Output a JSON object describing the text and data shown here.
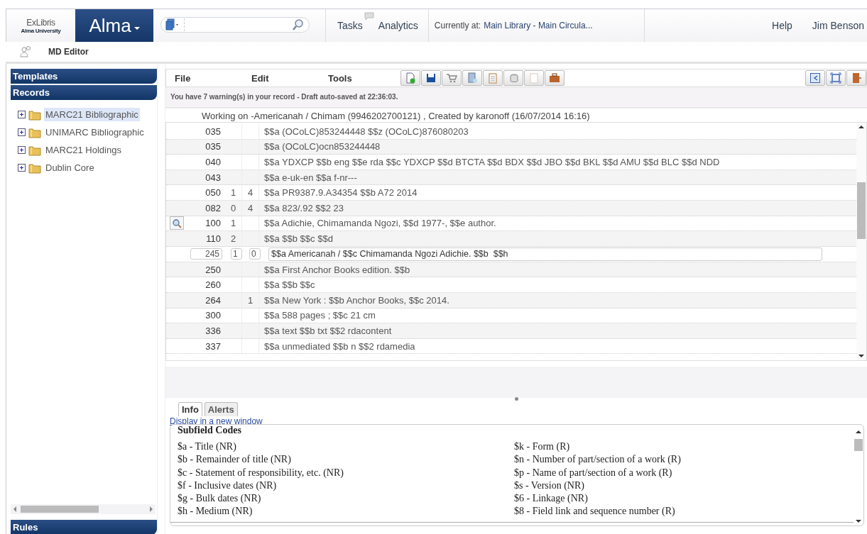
{
  "header": {
    "logo_top": "ExLibris",
    "logo_bottom": "Alma University",
    "app_name": "Alma",
    "nav": [
      "Tasks",
      "Analytics"
    ],
    "location_label": "Currently at:",
    "location": "Main Library - Main Circula...",
    "help": "Help",
    "user": "Jim Benson"
  },
  "subbar": {
    "title": "MD Editor"
  },
  "sidebar": {
    "sections": [
      "Templates",
      "Records"
    ],
    "items": [
      {
        "label": "MARC21 Bibliographic",
        "selected": true
      },
      {
        "label": "UNIMARC Bibliographic",
        "selected": false
      },
      {
        "label": "MARC21 Holdings",
        "selected": false
      },
      {
        "label": "Dublin Core",
        "selected": false
      }
    ],
    "footer": "Rules"
  },
  "editor": {
    "menu": [
      "File",
      "Edit",
      "Tools"
    ],
    "warning": "You have 7 warning(s) in your record - Draft auto-saved at 22:36:03.",
    "working_on": "Working on -Americanah / Chimam (9946202700121) , Created by karonoff (16/07/2014 16:16)",
    "rows": [
      {
        "kind": "field",
        "tag": "035",
        "ind1": "",
        "ind2": "",
        "value": "$$a (OCoLC)853244448 $$z (OCoLC)876080203",
        "lookup": false
      },
      {
        "kind": "field",
        "tag": "035",
        "ind1": "",
        "ind2": "",
        "value": "$$a (OCoLC)ocn853244448",
        "lookup": false
      },
      {
        "kind": "field",
        "tag": "040",
        "ind1": "",
        "ind2": "",
        "value": "$$a YDXCP $$b eng $$e rda $$c YDXCP $$d BTCTA $$d BDX $$d JBO $$d BKL $$d AMU $$d BLC $$d NDD",
        "lookup": false
      },
      {
        "kind": "field",
        "tag": "043",
        "ind1": "",
        "ind2": "",
        "value": "$$a e-uk-en $$a f-nr---",
        "lookup": false
      },
      {
        "kind": "field",
        "tag": "050",
        "ind1": "1",
        "ind2": "4",
        "value": "$$a PR9387.9.A34354 $$b A72 2014",
        "lookup": false
      },
      {
        "kind": "field",
        "tag": "082",
        "ind1": "0",
        "ind2": "4",
        "value": "$$a 823/.92 $$2 23",
        "lookup": false
      },
      {
        "kind": "field",
        "tag": "100",
        "ind1": "1",
        "ind2": "",
        "value": "$$a Adichie, Chimamanda Ngozi, $$d 1977-, $$e author.",
        "lookup": true
      },
      {
        "kind": "field",
        "tag": "110",
        "ind1": "2",
        "ind2": "",
        "value": "$$a $$b $$c $$d",
        "lookup": false
      },
      {
        "kind": "editing",
        "tag": "245",
        "ind1": "1",
        "ind2": "0",
        "value": "$$a Americanah / $$c Chimamanda Ngozi Adichie. $$b  $$h",
        "lookup": false
      },
      {
        "kind": "field",
        "tag": "250",
        "ind1": "",
        "ind2": "",
        "value": "$$a First Anchor Books edition. $$b",
        "lookup": false
      },
      {
        "kind": "field",
        "tag": "260",
        "ind1": "",
        "ind2": "",
        "value": "$$a $$b $$c",
        "lookup": false
      },
      {
        "kind": "field",
        "tag": "264",
        "ind1": "",
        "ind2": "1",
        "value": "$$a New York : $$b Anchor Books, $$c 2014.",
        "lookup": false
      },
      {
        "kind": "field",
        "tag": "300",
        "ind1": "",
        "ind2": "",
        "value": "$$a 588 pages ; $$c 21 cm",
        "lookup": false
      },
      {
        "kind": "field",
        "tag": "336",
        "ind1": "",
        "ind2": "",
        "value": "$$a text $$b txt $$2 rdacontent",
        "lookup": false
      },
      {
        "kind": "field",
        "tag": "337",
        "ind1": "",
        "ind2": "",
        "value": "$$a unmediated $$b n $$2 rdamedia",
        "lookup": false
      }
    ]
  },
  "info": {
    "tabs": [
      {
        "label": "Info",
        "selected": true
      },
      {
        "label": "Alerts",
        "selected": false
      }
    ],
    "link": "Display in a new window",
    "heading": "Subfield Codes",
    "left": [
      "$a - Title (NR)",
      "$b - Remainder of title (NR)",
      "$c - Statement of responsibility, etc. (NR)",
      "$f - Inclusive dates (NR)",
      "$g - Bulk dates (NR)",
      "$h - Medium (NR)"
    ],
    "right": [
      "$k - Form (R)",
      "$n - Number of part/section of a work (R)",
      "$p - Name of part/section of a work (R)",
      "$s - Version (NR)",
      "$6 - Linkage (NR)",
      "$8 - Field link and sequence number (R)"
    ]
  }
}
